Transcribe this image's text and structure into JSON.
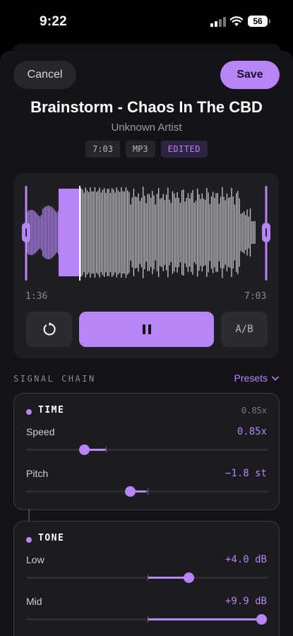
{
  "status_bar": {
    "time": "9:22",
    "battery": "56"
  },
  "header": {
    "cancel_label": "Cancel",
    "save_label": "Save"
  },
  "track": {
    "title": "Brainstorm - Chaos In The CBD",
    "artist": "Unknown Artist",
    "duration_badge": "7:03",
    "format_badge": "MP3",
    "status_badge": "EDITED"
  },
  "player": {
    "trim_start_time": "1:36",
    "trim_end_time": "7:03",
    "ab_label": "A/B",
    "playback_state": "playing"
  },
  "signal_chain": {
    "label": "SIGNAL CHAIN",
    "presets_label": "Presets",
    "modules": {
      "time": {
        "name": "TIME",
        "summary": "0.85x",
        "speed": {
          "label": "Speed",
          "value": "0.85x",
          "level": 0.24,
          "center": 0.33
        },
        "pitch": {
          "label": "Pitch",
          "value": "−1.8 st",
          "level": 0.43,
          "center": 0.5
        }
      },
      "tone": {
        "name": "TONE",
        "low": {
          "label": "Low",
          "value": "+4.0 dB",
          "level": 0.67,
          "center": 0.5
        },
        "mid": {
          "label": "Mid",
          "value": "+9.9 dB",
          "level": 0.97,
          "center": 0.5
        }
      }
    }
  },
  "colors": {
    "accent": "#b785f5",
    "background": "#141418",
    "card": "#1e1e23"
  }
}
